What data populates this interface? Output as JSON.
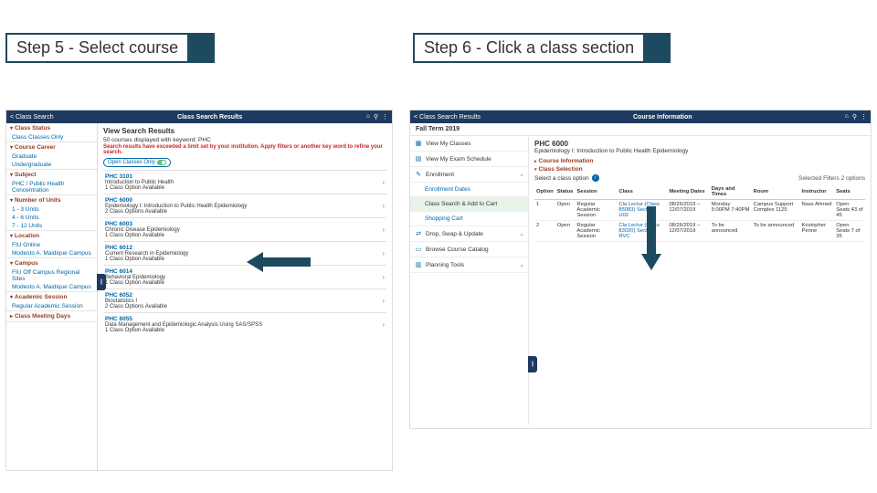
{
  "steps": {
    "step5": "Step 5 - Select course",
    "step6": "Step 6 - Click a class section"
  },
  "step5": {
    "topbar": {
      "back": "< Class Search",
      "title": "Class Search Results"
    },
    "filters": {
      "class_status": {
        "head": "Class Status",
        "items": [
          "Class Classes Only"
        ]
      },
      "course_career": {
        "head": "Course Career",
        "items": [
          "Graduate",
          "Undergraduate"
        ]
      },
      "subject": {
        "head": "Subject",
        "items": [
          "PHC / Public Health Concentration"
        ]
      },
      "units": {
        "head": "Number of Units",
        "items": [
          "1 - 3 Units",
          "4 - 6 Units",
          "7 - 12 Units"
        ]
      },
      "location": {
        "head": "Location",
        "items": [
          "FIU Online",
          "Modesto A. Maidique Campus"
        ]
      },
      "campus": {
        "head": "Campus",
        "items": [
          "FIU Off Campus Regional Sites",
          "Modesto A. Maidique Campus"
        ]
      },
      "session": {
        "head": "Academic Session",
        "items": [
          "Regular Academic Session"
        ]
      },
      "days": {
        "head": "Class Meeting Days"
      }
    },
    "main": {
      "heading": "View Search Results",
      "count": "50 courses displayed with keyword: PHC",
      "warning": "Search results have exceeded a limit set by your institution. Apply filters or another key word to refine your search.",
      "toggle": "Open Classes Only",
      "courses": [
        {
          "code": "PHC 3101",
          "title": "Introduction to Public Health",
          "avail": "1 Class Option Available"
        },
        {
          "code": "PHC 6000",
          "title": "Epidemiology I: Introduction to Public Health Epidemiology",
          "avail": "2 Class Options Available"
        },
        {
          "code": "PHC 6003",
          "title": "Chronic Disease Epidemiology",
          "avail": "1 Class Option Available"
        },
        {
          "code": "PHC 6012",
          "title": "Current Research in Epidemiology",
          "avail": "1 Class Option Available"
        },
        {
          "code": "PHC 6014",
          "title": "Behavioral Epidemiology",
          "avail": "1 Class Option Available"
        },
        {
          "code": "PHC 6052",
          "title": "Biostatistics I",
          "avail": "2 Class Options Available"
        },
        {
          "code": "PHC 6055",
          "title": "Data Management and Epidemiologic Analysis Using SAS/SPSS",
          "avail": "1 Class Option Available"
        }
      ]
    }
  },
  "step6": {
    "topbar": {
      "back": "< Class Search Results",
      "title": "Course Information"
    },
    "term": "Fall Term 2019",
    "nav": {
      "view_classes": "View My Classes",
      "view_exam": "View My Exam Schedule",
      "enrollment": "Enrollment",
      "enroll_dates": "Enrollment Dates",
      "search_add": "Class Search & Add to Cart",
      "cart": "Shopping Cart",
      "drop_swap": "Drop, Swap & Update",
      "browse": "Browse Course Catalog",
      "planning": "Planning Tools"
    },
    "course": {
      "code": "PHC 6000",
      "title": "Epidemiology I: Introduction to Public Health Epidemiology",
      "info_head": "Course Information",
      "selection_head": "Class Selection",
      "select_prompt": "Select a class option",
      "meta": "Selected Filters   2 options"
    },
    "table": {
      "headers": [
        "Option",
        "Status",
        "Session",
        "Class",
        "Meeting Dates",
        "Days and Times",
        "Room",
        "Instructor",
        "Seats"
      ],
      "rows": [
        {
          "option": "1",
          "status": "Open",
          "session": "Regular Academic Session",
          "class": "Cla Lectur (Class 85083) Section: U02",
          "dates": "08/26/2019 – 12/07/2019",
          "times": "Monday 5:00PM 7:40PM",
          "room": "Campus Support Complex 1125",
          "instructor": "Nass Ahmed",
          "seats": "Open Seats 43 of 45"
        },
        {
          "option": "2",
          "status": "Open",
          "session": "Regular Academic Session",
          "class": "Cla Lectur (Class 83020) Section: RVC",
          "dates": "08/26/2019 – 12/07/2019",
          "times": "To be announced",
          "room": "To be announced",
          "instructor": "Kristopher Penne",
          "seats": "Open Seats 7 of 35"
        }
      ]
    }
  }
}
